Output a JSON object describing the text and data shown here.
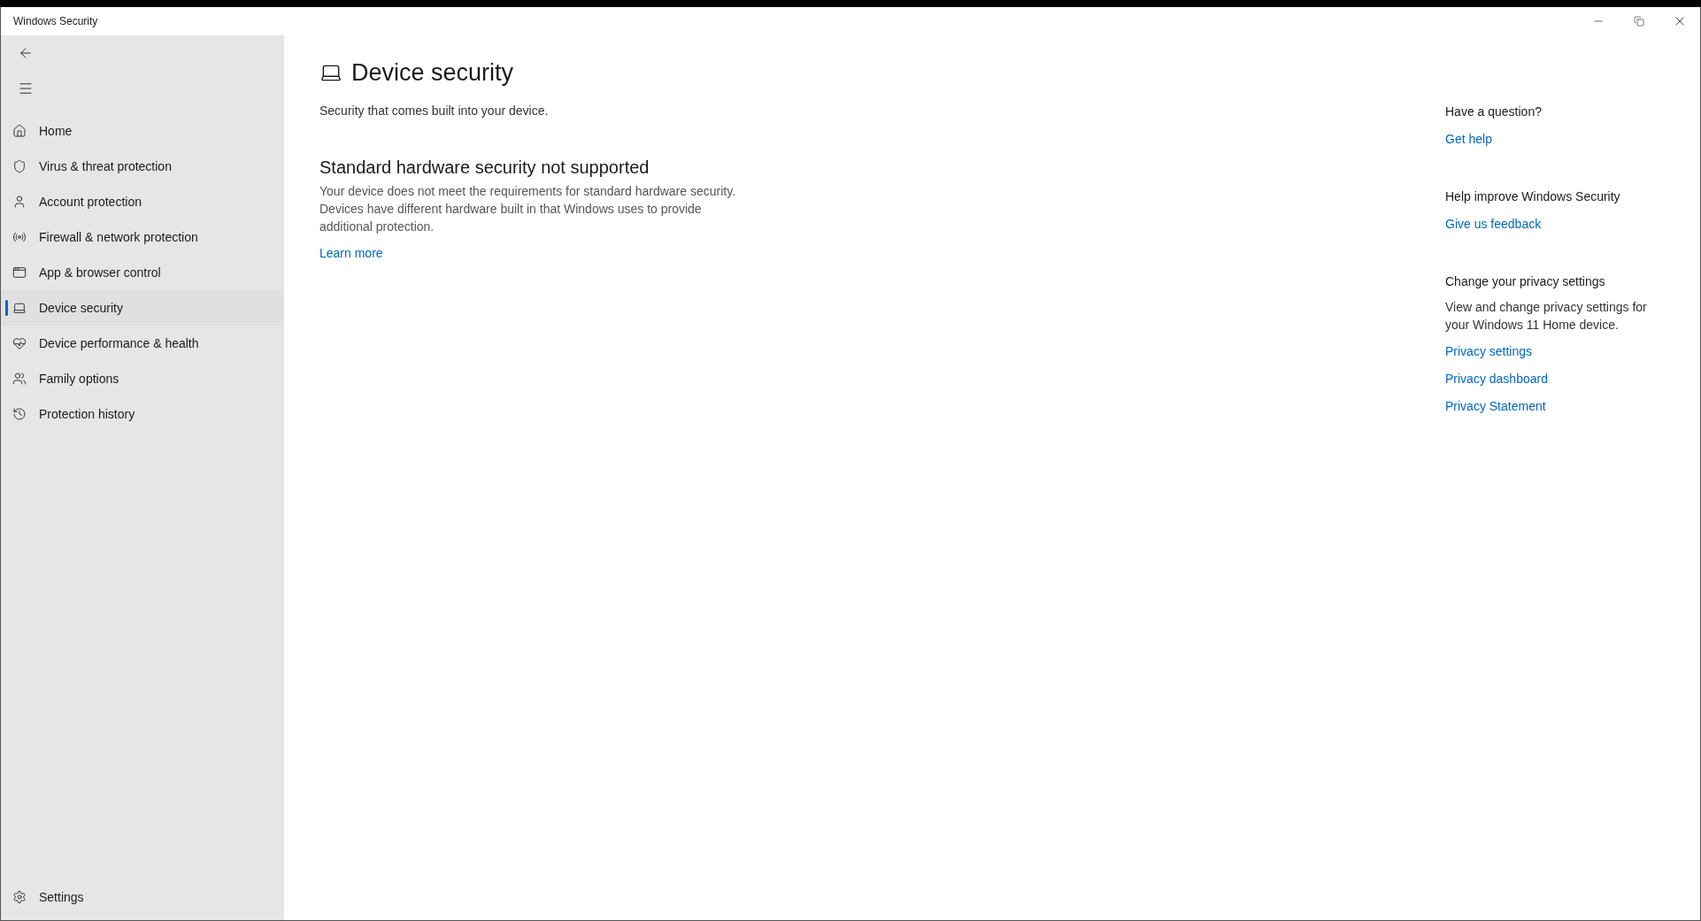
{
  "window": {
    "title": "Windows Security"
  },
  "sidebar": {
    "items": [
      {
        "label": "Home",
        "selected": false
      },
      {
        "label": "Virus & threat protection",
        "selected": false
      },
      {
        "label": "Account protection",
        "selected": false
      },
      {
        "label": "Firewall & network protection",
        "selected": false
      },
      {
        "label": "App & browser control",
        "selected": false
      },
      {
        "label": "Device security",
        "selected": true
      },
      {
        "label": "Device performance & health",
        "selected": false
      },
      {
        "label": "Family options",
        "selected": false
      },
      {
        "label": "Protection history",
        "selected": false
      }
    ],
    "settings": "Settings"
  },
  "page": {
    "title": "Device security",
    "subtitle": "Security that comes built into your device.",
    "section": {
      "heading": "Standard hardware security not supported",
      "body": "Your device does not meet the requirements for standard hardware security. Devices have different hardware built in that Windows uses to provide additional protection.",
      "link": "Learn more"
    }
  },
  "aside": [
    {
      "heading": "Have a question?",
      "links": [
        "Get help"
      ]
    },
    {
      "heading": "Help improve Windows Security",
      "links": [
        "Give us feedback"
      ]
    },
    {
      "heading": "Change your privacy settings",
      "text": "View and change privacy settings for your Windows 11 Home device.",
      "links": [
        "Privacy settings",
        "Privacy dashboard",
        "Privacy Statement"
      ]
    }
  ]
}
